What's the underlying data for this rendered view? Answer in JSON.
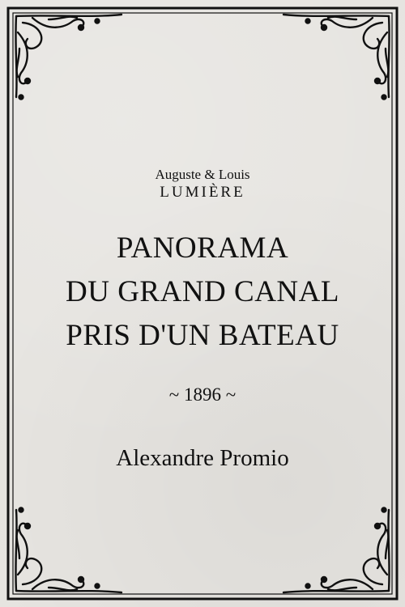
{
  "poster": {
    "credit_line": "Auguste & Louis",
    "credit_name": "LUMIÈRE",
    "title_lines": [
      "PANORAMA",
      "DU GRAND CANAL",
      "PRIS D'UN BATEAU"
    ],
    "year": "~ 1896 ~",
    "director": "Alexandre Promio"
  },
  "colors": {
    "background": "#e6e4e0",
    "ink": "#111111"
  },
  "icons": {
    "corner_ornament": "flourish-corner-icon"
  }
}
